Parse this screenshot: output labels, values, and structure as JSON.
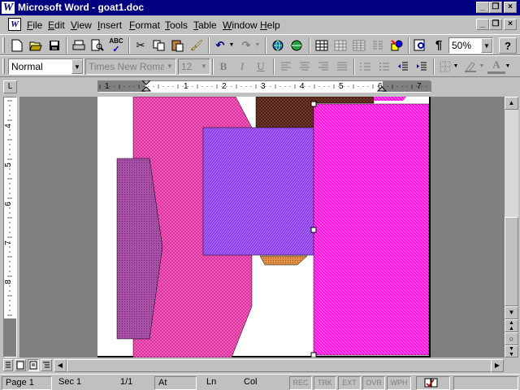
{
  "titlebar": {
    "title": "Microsoft Word - goat1.doc",
    "app_icon": "W",
    "controls": [
      "_",
      "❐",
      "×"
    ]
  },
  "menubar": {
    "doc_icon": "W",
    "items": [
      "File",
      "Edit",
      "View",
      "Insert",
      "Format",
      "Tools",
      "Table",
      "Window",
      "Help"
    ],
    "doc_controls": [
      "_",
      "❐",
      "×"
    ]
  },
  "standard_toolbar": {
    "icons": [
      "new-document-icon",
      "open-folder-icon",
      "save-icon",
      "print-icon",
      "print-preview-icon",
      "spelling-icon",
      "cut-icon",
      "copy-icon",
      "paste-icon",
      "format-painter-icon",
      "undo-icon",
      "redo-icon",
      "insert-hyperlink-icon",
      "web-toolbar-icon",
      "tables-borders-icon",
      "insert-table-icon",
      "insert-excel-icon",
      "columns-icon",
      "drawing-icon",
      "document-map-icon",
      "show-hide-icon",
      "help-icon"
    ],
    "zoom": "50%"
  },
  "formatting_toolbar": {
    "style": "Normal",
    "font": "Times New Roman",
    "size": "12",
    "bold": "B",
    "italic": "I",
    "underline": "U",
    "icons": [
      "align-left-icon",
      "center-icon",
      "align-right-icon",
      "justify-icon",
      "numbering-icon",
      "bullets-icon",
      "decrease-indent-icon",
      "increase-indent-icon",
      "borders-icon",
      "highlight-icon",
      "font-color-icon"
    ]
  },
  "ruler": {
    "corner": "L",
    "numbers": [
      "1",
      "1",
      "2",
      "3",
      "4",
      "5",
      "6",
      "7"
    ],
    "vertical_numbers": [
      "4",
      "5",
      "6",
      "7",
      "8"
    ]
  },
  "document": {
    "shapes": [
      {
        "name": "shape-pink-main",
        "color": "#dd2a9b"
      },
      {
        "name": "shape-mauve-left",
        "color": "#a850a8"
      },
      {
        "name": "shape-brown-top",
        "color": "#7a3a2a"
      },
      {
        "name": "shape-violet-center",
        "color": "#8a3dee"
      },
      {
        "name": "shape-orange-bottom",
        "color": "#e09048"
      },
      {
        "name": "shape-magenta-right",
        "color": "#ff10e0"
      }
    ]
  },
  "view_buttons": [
    "normal-view-icon",
    "web-layout-icon",
    "print-layout-icon",
    "outline-view-icon"
  ],
  "statusbar": {
    "page": "Page 1",
    "section": "Sec 1",
    "page_of": "1/1",
    "at": "At",
    "line": "Ln",
    "col": "Col",
    "modes": [
      "REC",
      "TRK",
      "EXT",
      "OVR",
      "WPH"
    ],
    "book_icon": "spelling-status-icon"
  }
}
